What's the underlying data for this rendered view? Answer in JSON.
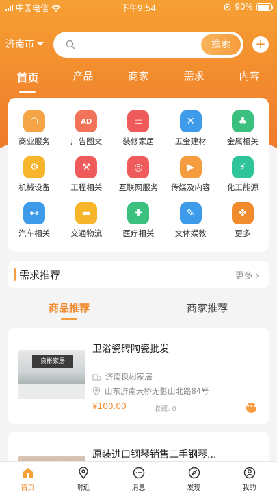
{
  "status_bar": {
    "carrier": "中国电信",
    "time": "下午9:54",
    "battery": "90%",
    "battery_level": 0.9
  },
  "topbar": {
    "city": "济南市",
    "search_placeholder": "",
    "search_button": "搜索",
    "add_icon": "plus-icon"
  },
  "tabs": [
    {
      "label": "首页",
      "active": true
    },
    {
      "label": "产品"
    },
    {
      "label": "商家"
    },
    {
      "label": "需求"
    },
    {
      "label": "内容"
    }
  ],
  "categories": [
    {
      "label": "商业服务",
      "icon": "shop-icon",
      "color": "#f5a545",
      "glyph": "☖"
    },
    {
      "label": "广告图文",
      "icon": "ad-icon",
      "color": "#f2735a",
      "glyph": "AD"
    },
    {
      "label": "装修家居",
      "icon": "sofa-icon",
      "color": "#ef5b5b",
      "glyph": "▭"
    },
    {
      "label": "五金建材",
      "icon": "tools-icon",
      "color": "#3d9be9",
      "glyph": "✕"
    },
    {
      "label": "金属相关",
      "icon": "metal-icon",
      "color": "#3cc07f",
      "glyph": "♣"
    },
    {
      "label": "机械设备",
      "icon": "machine-icon",
      "color": "#f6b52b",
      "glyph": "⚙"
    },
    {
      "label": "工程相关",
      "icon": "excavator-icon",
      "color": "#ef5b5b",
      "glyph": "⚒"
    },
    {
      "label": "互联网服务",
      "icon": "internet-icon",
      "color": "#ef5b5b",
      "glyph": "◎"
    },
    {
      "label": "传媒及内容",
      "icon": "camera-icon",
      "color": "#f59c3e",
      "glyph": "▶"
    },
    {
      "label": "化工能源",
      "icon": "energy-icon",
      "color": "#2fc59a",
      "glyph": "⚡"
    },
    {
      "label": "汽车相关",
      "icon": "car-icon",
      "color": "#3d9be9",
      "glyph": "⊷"
    },
    {
      "label": "交通物流",
      "icon": "truck-icon",
      "color": "#f6b52b",
      "glyph": "▬"
    },
    {
      "label": "医疗相关",
      "icon": "medical-icon",
      "color": "#3cc07f",
      "glyph": "✚"
    },
    {
      "label": "文体娱教",
      "icon": "sport-icon",
      "color": "#3d9be9",
      "glyph": "✎"
    },
    {
      "label": "更多",
      "icon": "more-icon",
      "color": "#f28a2e",
      "glyph": "✤"
    }
  ],
  "demand": {
    "title": "需求推荐",
    "more": "更多"
  },
  "sub_tabs": [
    {
      "label": "商品推荐",
      "active": true
    },
    {
      "label": "商家推荐"
    }
  ],
  "products": [
    {
      "name": "卫浴瓷砖陶瓷批发",
      "shop": "济南良彬家居",
      "address": "山东济南天桥无影山北路84号",
      "price": "¥100.00",
      "sales": "收藏: 0",
      "sign_text": "良彬家居"
    },
    {
      "name": "原装进口钢琴销售二手钢琴..."
    }
  ],
  "bottom_nav": [
    {
      "label": "首页",
      "icon": "home-icon",
      "active": true
    },
    {
      "label": "附近",
      "icon": "location-icon"
    },
    {
      "label": "消息",
      "icon": "message-icon"
    },
    {
      "label": "发现",
      "icon": "compass-icon"
    },
    {
      "label": "我的",
      "icon": "user-icon"
    }
  ],
  "colors": {
    "accent": "#f28a2e",
    "header_top": "#f6a033",
    "price": "#f28a2e"
  }
}
